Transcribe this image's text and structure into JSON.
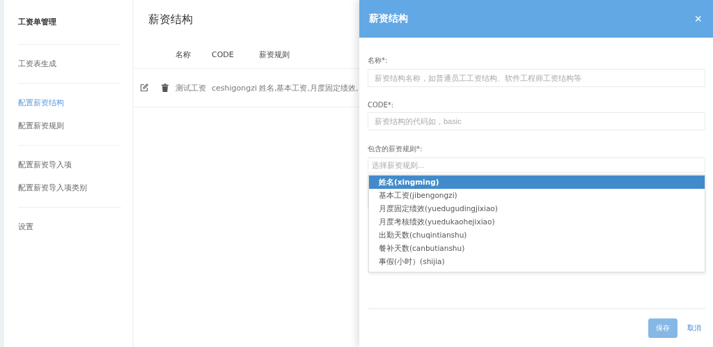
{
  "sidebar": {
    "groups": [
      {
        "items": [
          {
            "label": "工资单管理",
            "kind": "heading",
            "selected": false
          }
        ]
      },
      {
        "items": [
          {
            "label": "工资表生成",
            "kind": "link",
            "selected": false
          }
        ]
      },
      {
        "items": [
          {
            "label": "配置薪资结构",
            "kind": "link",
            "selected": true
          },
          {
            "label": "配置薪资规则",
            "kind": "link",
            "selected": false
          }
        ]
      },
      {
        "items": [
          {
            "label": "配置薪资导入项",
            "kind": "link",
            "selected": false
          },
          {
            "label": "配置薪资导入项类别",
            "kind": "link",
            "selected": false
          }
        ]
      },
      {
        "items": [
          {
            "label": "设置",
            "kind": "link",
            "selected": false
          }
        ]
      }
    ]
  },
  "main": {
    "title": "薪资结构",
    "table": {
      "columns": [
        "名称",
        "CODE",
        "薪资规则"
      ],
      "rows": [
        {
          "cells": [
            "测试工资",
            "ceshigongzi",
            "姓名,基本工资,月度固定绩效,"
          ]
        }
      ]
    }
  },
  "drawer": {
    "title": "薪资结构",
    "close": "×",
    "fields": [
      {
        "label": "名称*:",
        "placeholder": "薪资结构名称，如普通员工工资结构、软件工程师工资结构等"
      },
      {
        "label": "CODE*:",
        "placeholder": "薪资结构的代码如，basic"
      }
    ],
    "select": {
      "label": "包含的薪资规则*:",
      "placeholder": "选择薪资规则...",
      "options": [
        {
          "label": "姓名(xingming)",
          "selected": true
        },
        {
          "label": "基本工资(jibengongzi)",
          "selected": false
        },
        {
          "label": "月度固定绩效(yuedugudingjixiao)",
          "selected": false
        },
        {
          "label": "月度考核绩效(yuedukaohejixiao)",
          "selected": false
        },
        {
          "label": "出勤天数(chuqintianshu)",
          "selected": false
        },
        {
          "label": "餐补天数(canbutianshu)",
          "selected": false
        },
        {
          "label": "事假(小时）(shijia)",
          "selected": false
        }
      ]
    },
    "save": {
      "label": "保存",
      "disabled": true
    },
    "cancel": "取消"
  }
}
